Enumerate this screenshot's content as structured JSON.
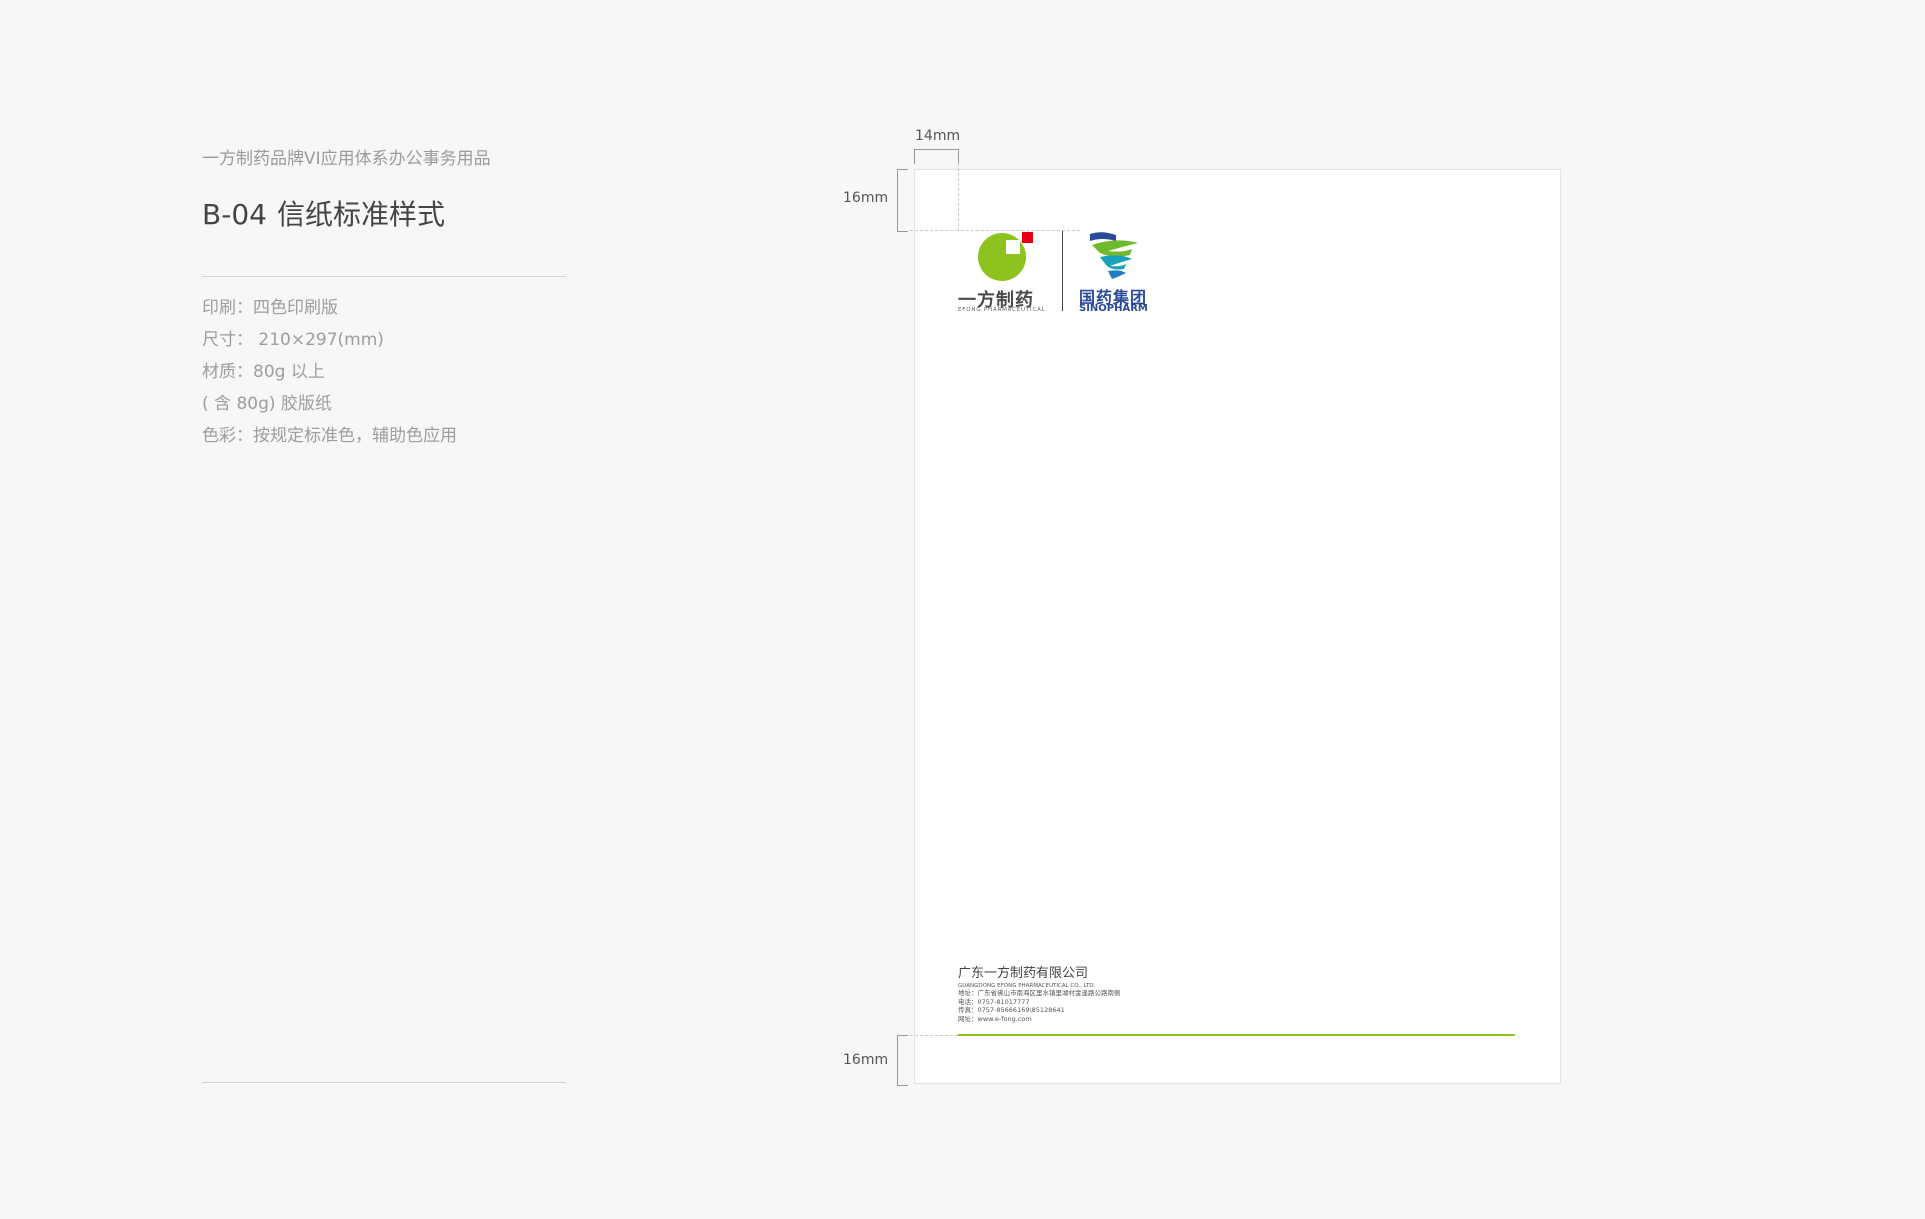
{
  "header": {
    "subtitle": "一方制药品牌VI应用体系办公事务用品",
    "code": "B-04",
    "title": "信纸标准样式"
  },
  "specs": [
    "印刷：四色印刷版",
    "尺寸： 210×297(mm)",
    "材质：80g 以上",
    "( 含 80g) 胶版纸",
    "色彩：按规定标准色，辅助色应用"
  ],
  "dimensions": {
    "left_margin": "14mm",
    "top_margin": "16mm",
    "bottom_margin": "16mm"
  },
  "logos": {
    "efong_cn": "一方制药",
    "efong_en": "EFONG PHARMACEUTICAL",
    "sino_cn": "国药集团",
    "sino_en": "SINOPHARM"
  },
  "footer": {
    "company_cn": "广东一方制药有限公司",
    "company_en": "GUANGDONG EFONG PHARMACEUTICAL CO., LTD.",
    "address": "地址：广东省佛山市南海区里水镇里湖村金逢路公路南侧",
    "phone": "电话：0757-81017777",
    "fax": "传真：0757-85666169\\85128641",
    "web": "网址：www.e-fong.com"
  },
  "colors": {
    "accent_green": "#8dc21f",
    "accent_red": "#e60012",
    "sinopharm_blue": "#2a4a9a",
    "background": "#f7f7f7"
  },
  "icons": [
    "efong-logo-icon",
    "sinopharm-logo-icon"
  ]
}
